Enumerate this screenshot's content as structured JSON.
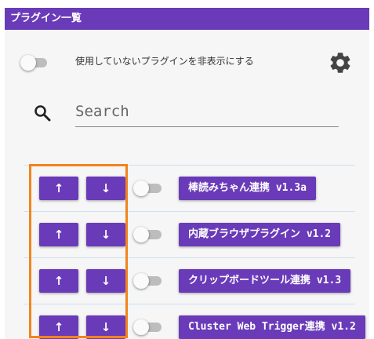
{
  "window": {
    "title": "プラグイン一覧"
  },
  "settings": {
    "hide_unused_label": "使用していないプラグインを非表示にする",
    "gear_icon": "gear-icon"
  },
  "search": {
    "placeholder": "Search",
    "icon": "search-icon"
  },
  "plugins": [
    {
      "up_label": "↑",
      "down_label": "↓",
      "name": "棒読みちゃん連携 v1.3a",
      "enabled": false
    },
    {
      "up_label": "↑",
      "down_label": "↓",
      "name": "内蔵ブラウザプラグイン v1.2",
      "enabled": false
    },
    {
      "up_label": "↑",
      "down_label": "↓",
      "name": "クリップボードツール連携 v1.3",
      "enabled": false
    },
    {
      "up_label": "↑",
      "down_label": "↓",
      "name": "Cluster Web Trigger連携 v1.2",
      "enabled": false
    }
  ],
  "colors": {
    "accent": "#6a3bb8",
    "highlight": "#f2841e",
    "toggle_off": "#bdbdbd"
  }
}
